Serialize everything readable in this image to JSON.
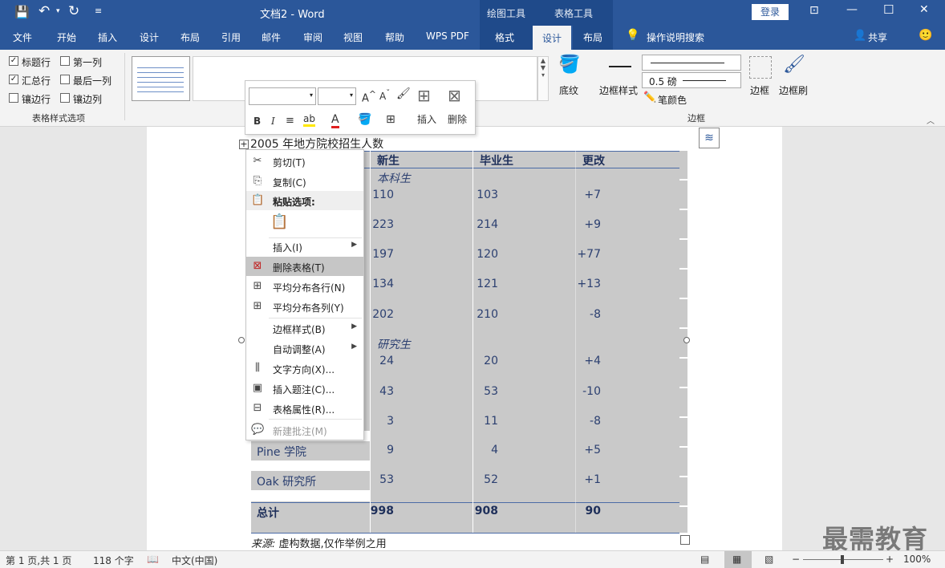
{
  "titlebar": {
    "doc_title": "文档2  -  Word",
    "ctx_tools_1": "绘图工具",
    "ctx_tools_2": "表格工具",
    "login": "登录",
    "minimize": "—",
    "maximize": "☐",
    "close": "✕"
  },
  "tabs": [
    "文件",
    "开始",
    "插入",
    "设计",
    "布局",
    "引用",
    "邮件",
    "审阅",
    "视图",
    "帮助",
    "WPS PDF",
    "格式",
    "设计",
    "布局"
  ],
  "tell_me": "操作说明搜索",
  "share": "共享",
  "ribbon": {
    "style_options": {
      "header_row": "标题行",
      "first_col": "第一列",
      "total_row": "汇总行",
      "last_col": "最后一列",
      "banded_rows": "镶边行",
      "banded_cols": "镶边列",
      "group_name": "表格样式选项"
    },
    "shading": "底纹",
    "border_styles": "边框样式",
    "pen_weight": "0.5 磅",
    "pen_color": "笔颜色",
    "borders": "边框",
    "border_painter": "边框刷",
    "borders_group": "边框"
  },
  "mini_toolbar": {
    "insert": "插入",
    "delete": "删除",
    "bold": "B",
    "italic": "I"
  },
  "context_menu": {
    "cut": "剪切(T)",
    "copy": "复制(C)",
    "paste_options": "粘贴选项:",
    "insert": "插入(I)",
    "delete_table": "删除表格(T)",
    "distribute_rows": "平均分布各行(N)",
    "distribute_cols": "平均分布各列(Y)",
    "border_styles": "边框样式(B)",
    "autofit": "自动调整(A)",
    "text_direction": "文字方向(X)...",
    "insert_caption": "插入题注(C)...",
    "table_props": "表格属性(R)...",
    "new_comment": "新建批注(M)"
  },
  "table": {
    "caption": "2005 年地方院校招生人数",
    "headers": [
      "新生",
      "毕业生",
      "更改"
    ],
    "section1": "本科生",
    "section2": "研究生",
    "rows_ug": [
      [
        "110",
        "103",
        "+7"
      ],
      [
        "223",
        "214",
        "+9"
      ],
      [
        "197",
        "120",
        "+77"
      ],
      [
        "134",
        "121",
        "+13"
      ],
      [
        "202",
        "210",
        "-8"
      ]
    ],
    "rows_g": [
      [
        "24",
        "20",
        "+4"
      ],
      [
        "43",
        "53",
        "-10"
      ],
      [
        "3",
        "11",
        "-8"
      ]
    ],
    "pine": {
      "label": "Pine  学院",
      "vals": [
        "9",
        "4",
        "+5"
      ]
    },
    "oak": {
      "label": "Oak  研究所",
      "vals": [
        "53",
        "52",
        "+1"
      ]
    },
    "total": {
      "label": "总计",
      "vals": [
        "998",
        "908",
        "90"
      ]
    },
    "source_label": "来源:",
    "source_text": " 虚构数据,仅作举例之用"
  },
  "status": {
    "page": "第 1 页,共 1 页",
    "words": "118 个字",
    "lang": "中文(中国)",
    "zoom": "100%"
  },
  "watermark": "最需教育"
}
